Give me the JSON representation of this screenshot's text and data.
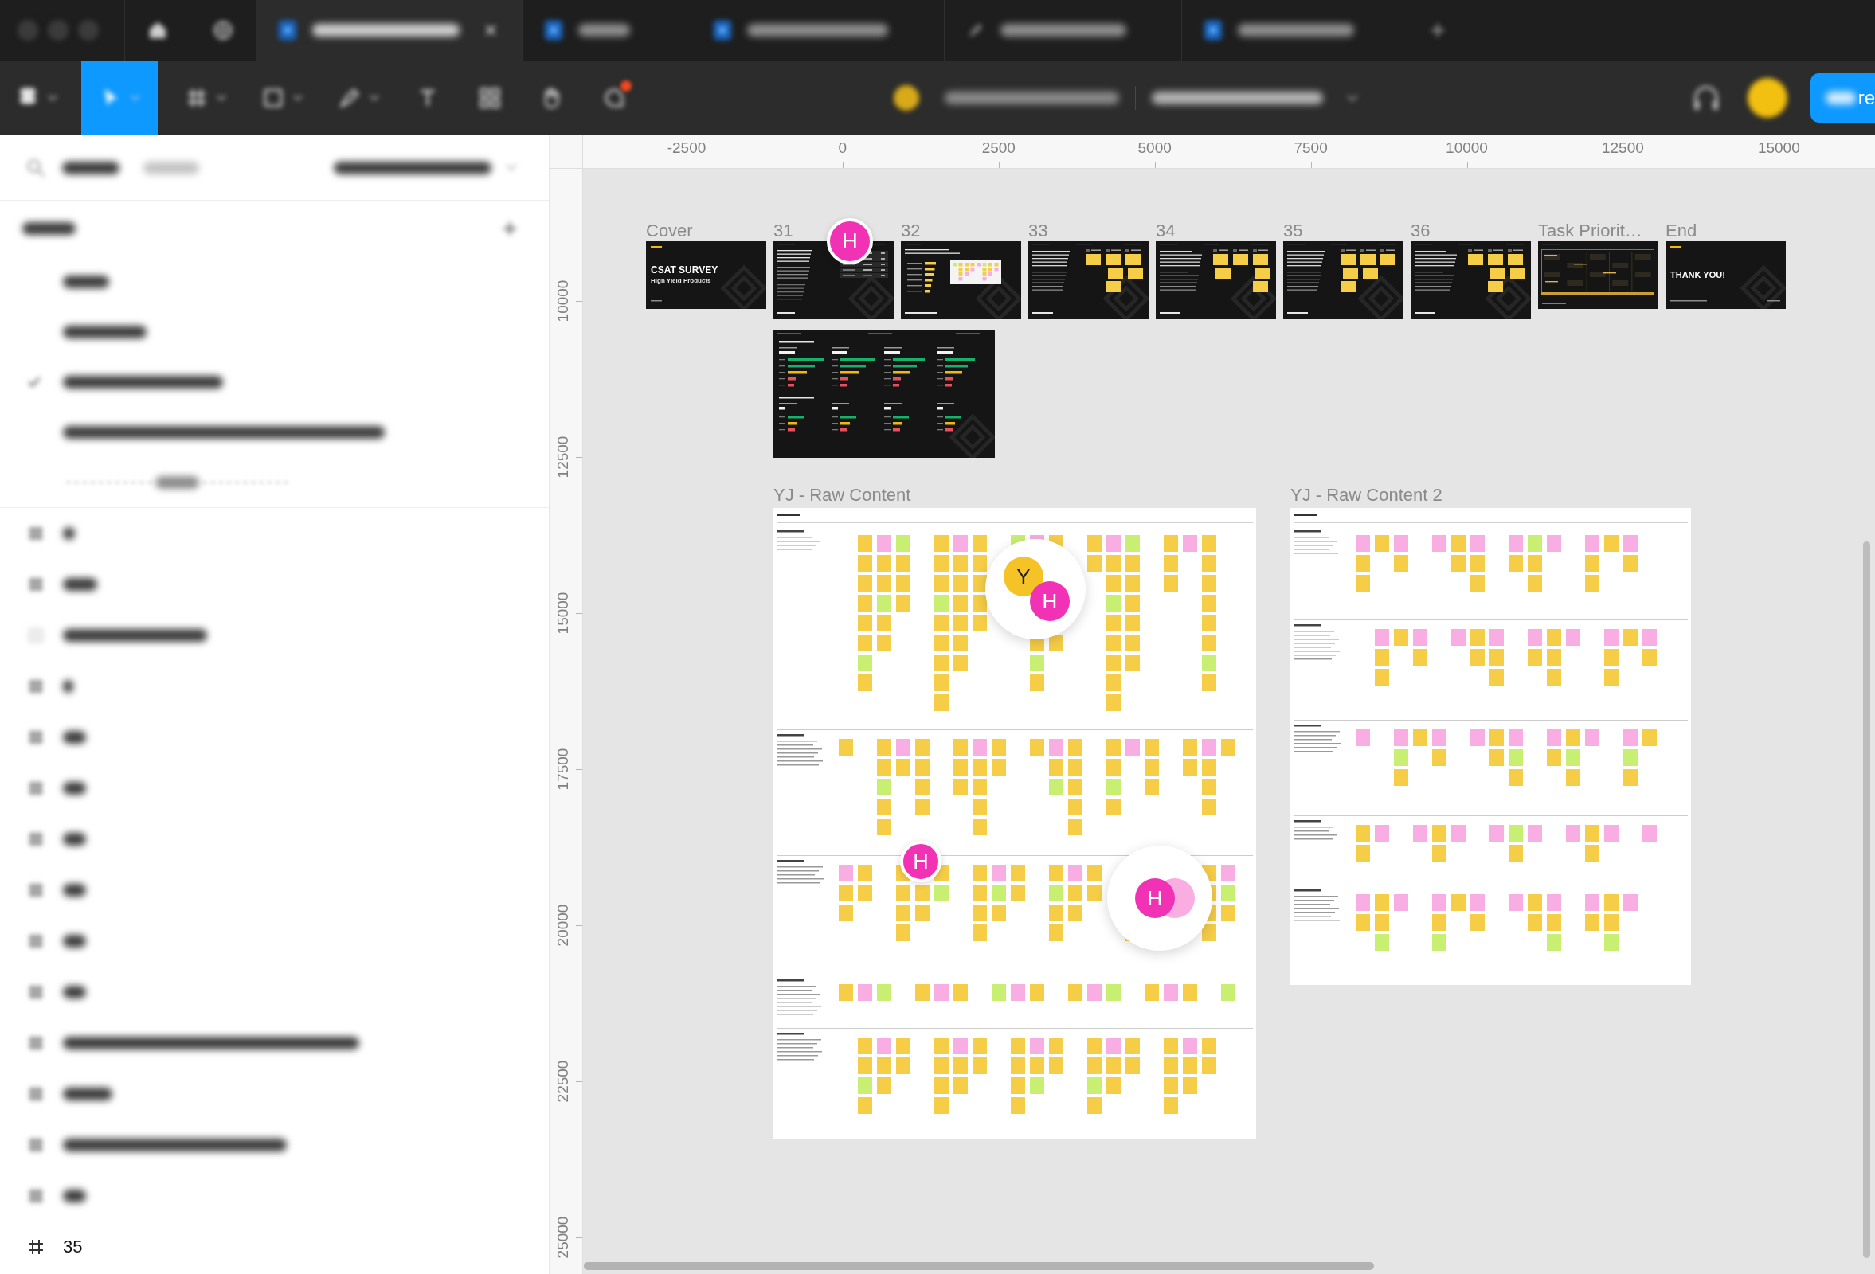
{
  "tab_bar": {
    "tabs": [
      {
        "kind": "home",
        "selected": false
      },
      {
        "kind": "community",
        "selected": false
      },
      {
        "kind": "design",
        "selected": true,
        "title_blurred": true
      },
      {
        "kind": "design",
        "selected": false,
        "title_blurred": true
      },
      {
        "kind": "design",
        "selected": false,
        "title_blurred": true
      },
      {
        "kind": "draft",
        "selected": false,
        "title_blurred": true
      },
      {
        "kind": "design",
        "selected": false,
        "title_blurred": true
      }
    ]
  },
  "toolbar": {
    "tools": [
      {
        "kind": "menu",
        "selected": false,
        "dropdown": true,
        "notification": false
      },
      {
        "kind": "move",
        "selected": true,
        "dropdown": true,
        "notification": false
      },
      {
        "kind": "frame",
        "selected": false,
        "dropdown": true,
        "notification": false
      },
      {
        "kind": "shape",
        "selected": false,
        "dropdown": true,
        "notification": false
      },
      {
        "kind": "pen",
        "selected": false,
        "dropdown": true,
        "notification": false
      },
      {
        "kind": "text",
        "selected": false,
        "dropdown": false,
        "notification": false
      },
      {
        "kind": "resources",
        "selected": false,
        "dropdown": false,
        "notification": false
      },
      {
        "kind": "hand",
        "selected": false,
        "dropdown": false,
        "notification": false
      },
      {
        "kind": "comment",
        "selected": false,
        "dropdown": false,
        "notification": true
      }
    ],
    "breadcrumb": [
      {
        "title_blurred": true
      },
      {
        "title_blurred": true
      }
    ],
    "share_button": {
      "label": "re"
    }
  },
  "layers_panel": {
    "header_blurred": true,
    "pages_heading_blurred": true,
    "pages": [
      {
        "kind": "page",
        "selected": false,
        "title_blurred": true
      },
      {
        "kind": "page",
        "selected": false,
        "title_blurred": true
      },
      {
        "kind": "page",
        "selected": true,
        "title_blurred": true
      },
      {
        "kind": "page",
        "selected": false,
        "title_blurred": true
      },
      {
        "kind": "separator",
        "selected": false,
        "title_blurred": true
      }
    ],
    "layers": [
      {
        "kind": "frame",
        "title_blurred": true
      },
      {
        "kind": "frame",
        "title_blurred": true
      },
      {
        "kind": "rectangle",
        "title_blurred": true
      },
      {
        "kind": "frame",
        "title_blurred": true
      },
      {
        "kind": "frame",
        "title_blurred": true
      },
      {
        "kind": "frame",
        "title_blurred": true
      },
      {
        "kind": "frame",
        "title_blurred": true
      },
      {
        "kind": "frame",
        "title_blurred": true
      },
      {
        "kind": "frame",
        "title_blurred": true
      },
      {
        "kind": "frame",
        "title_blurred": true
      },
      {
        "kind": "frame",
        "title_blurred": true
      },
      {
        "kind": "frame",
        "title_blurred": true
      },
      {
        "kind": "frame",
        "title_blurred": true
      },
      {
        "kind": "frame",
        "title_blurred": true
      },
      {
        "kind": "frame",
        "title_blurred": false,
        "name": "35"
      }
    ]
  },
  "canvas": {
    "rulers": {
      "horizontal": [
        "-2500",
        "0",
        "2500",
        "5000",
        "7500",
        "10000",
        "12500",
        "15000"
      ],
      "vertical": [
        "10000",
        "12500",
        "15000",
        "17500",
        "20000",
        "22500",
        "25000"
      ]
    },
    "slides": [
      {
        "label": "Cover",
        "kind": "cover",
        "title": "CSAT SURVEY",
        "subtitle": "High Yield Products"
      },
      {
        "label": "31",
        "kind": "table"
      },
      {
        "label": "32",
        "kind": "map"
      },
      {
        "label": "33",
        "kind": "notes"
      },
      {
        "label": "34",
        "kind": "notes"
      },
      {
        "label": "35",
        "kind": "notes"
      },
      {
        "label": "36",
        "kind": "notes"
      },
      {
        "label": "Task Priorit…",
        "kind": "timeline"
      },
      {
        "label": "End",
        "kind": "end",
        "title": "THANK YOU!"
      }
    ],
    "detached_slides": [
      {
        "kind": "dashboard"
      }
    ],
    "boards": [
      {
        "label": "YJ - Raw Content"
      },
      {
        "label": "YJ - Raw Content 2"
      }
    ],
    "presence": [
      {
        "kind": "pin",
        "stacked": false,
        "avatars": [
          {
            "initial": "H",
            "color": "#f232b5"
          }
        ]
      },
      {
        "kind": "halo",
        "stacked": false,
        "avatars": [
          {
            "initial": "Y",
            "color": "#f6c326"
          },
          {
            "initial": "H",
            "color": "#f232b5"
          }
        ]
      },
      {
        "kind": "pin",
        "stacked": false,
        "avatars": [
          {
            "initial": "H",
            "color": "#f232b5"
          }
        ]
      },
      {
        "kind": "halo",
        "stacked": true,
        "avatars": [
          {
            "initial": "H",
            "color": "#f232b5"
          }
        ]
      }
    ]
  }
}
